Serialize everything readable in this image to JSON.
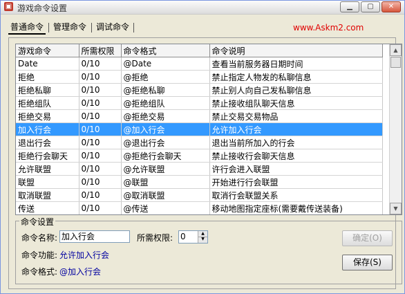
{
  "window": {
    "title": "游戏命令设置",
    "icon": "app-icon"
  },
  "tabs": [
    {
      "label": "普通命令",
      "active": true
    },
    {
      "label": "管理命令",
      "active": false
    },
    {
      "label": "调试命令",
      "active": false
    }
  ],
  "brand": "www.Askm2.com",
  "table": {
    "columns": [
      "游戏命令",
      "所需权限",
      "命令格式",
      "命令说明"
    ],
    "rows": [
      {
        "name": "Date",
        "perm": "0/10",
        "format": "@Date",
        "desc": "查看当前服务器日期时间"
      },
      {
        "name": "拒绝",
        "perm": "0/10",
        "format": "@拒绝",
        "desc": "禁止指定人物发的私聊信息"
      },
      {
        "name": "拒绝私聊",
        "perm": "0/10",
        "format": "@拒绝私聊",
        "desc": "禁止别人向自己发私聊信息"
      },
      {
        "name": "拒绝组队",
        "perm": "0/10",
        "format": "@拒绝组队",
        "desc": "禁止接收组队聊天信息"
      },
      {
        "name": "拒绝交易",
        "perm": "0/10",
        "format": "@拒绝交易",
        "desc": "禁止交易交易物品"
      },
      {
        "name": "加入行会",
        "perm": "0/10",
        "format": "@加入行会",
        "desc": "允许加入行会"
      },
      {
        "name": "退出行会",
        "perm": "0/10",
        "format": "@退出行会",
        "desc": "退出当前所加入的行会"
      },
      {
        "name": "拒绝行会聊天",
        "perm": "0/10",
        "format": "@拒绝行会聊天",
        "desc": "禁止接收行会聊天信息"
      },
      {
        "name": "允许联盟",
        "perm": "0/10",
        "format": "@允许联盟",
        "desc": "许行会进入联盟"
      },
      {
        "name": "联盟",
        "perm": "0/10",
        "format": "@联盟",
        "desc": "开始进行行会联盟"
      },
      {
        "name": "取消联盟",
        "perm": "0/10",
        "format": "@取消联盟",
        "desc": "取消行会联盟关系"
      },
      {
        "name": "传送",
        "perm": "0/10",
        "format": "@传送",
        "desc": "移动地图指定座标(需要戴传送装备)"
      }
    ],
    "selected_index": 5
  },
  "settings": {
    "group_title": "命令设置",
    "name_label": "命令名称:",
    "name_value": "加入行会",
    "perm_label": "所需权限:",
    "perm_value": "0",
    "func_label": "命令功能:",
    "func_value": "允许加入行会",
    "format_label": "命令格式:",
    "format_value": "@加入行会"
  },
  "buttons": {
    "confirm": "确定(O)",
    "save": "保存(S)"
  },
  "colors": {
    "selection": "#3399ff",
    "brand": "#e00000",
    "value_text": "#0000a0"
  }
}
